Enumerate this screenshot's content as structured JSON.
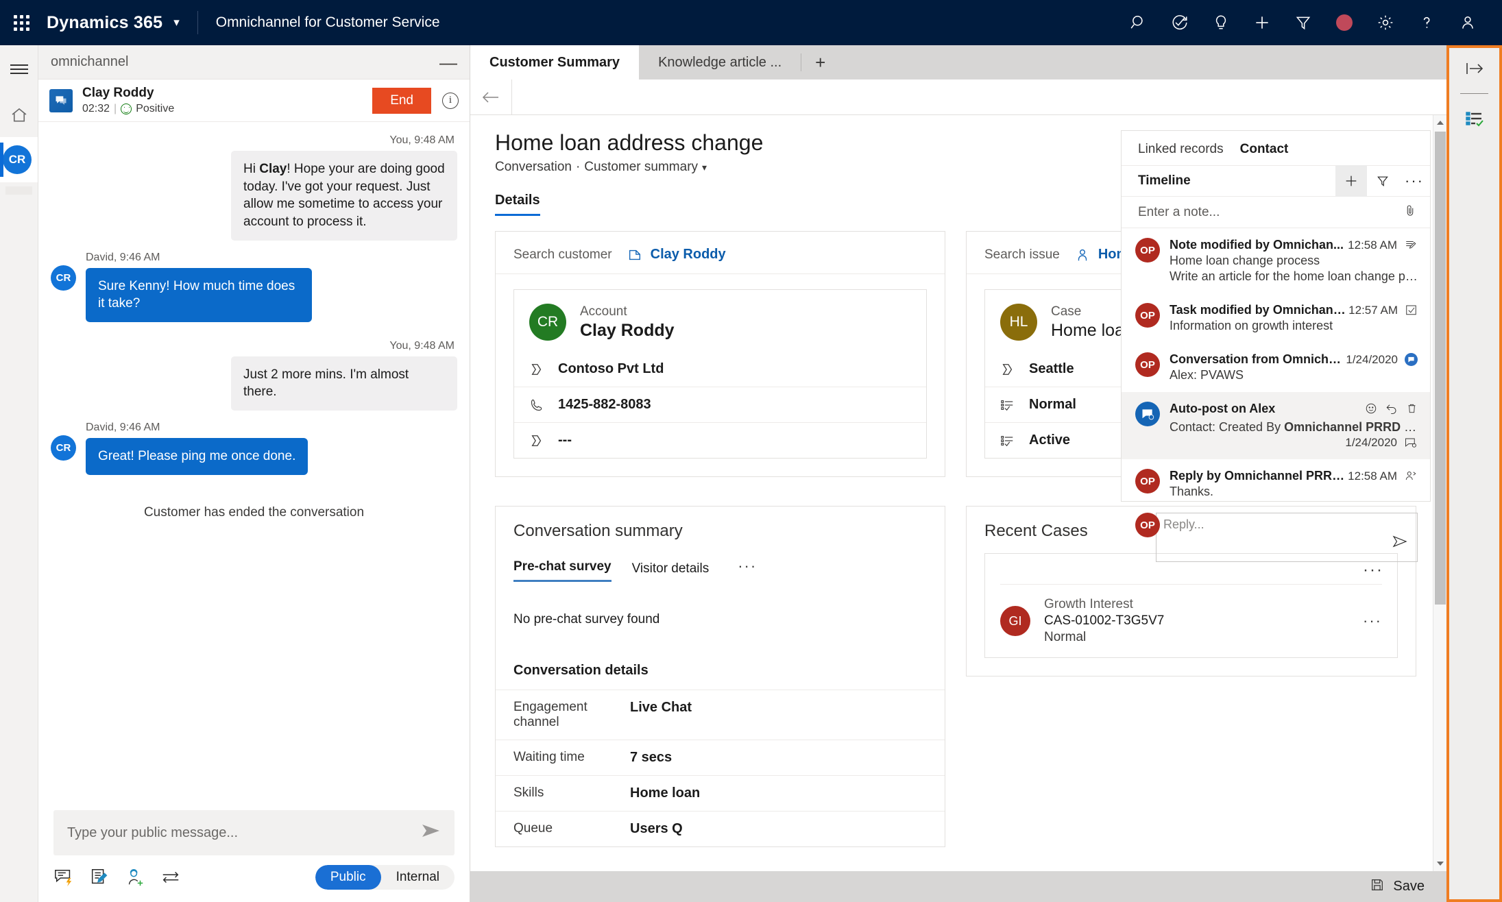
{
  "topnav": {
    "brand": "Dynamics 365",
    "app_name": "Omnichannel for Customer Service",
    "icons": [
      "search-icon",
      "check-circle-arrow-icon",
      "lightbulb-icon",
      "plus-icon",
      "filter-icon",
      "presence-busy-dot",
      "gear-icon",
      "help-question-icon",
      "user-account-icon"
    ]
  },
  "rail": {
    "hamburger": "site-map-menu",
    "home": "home-icon",
    "agent_initials": "CR"
  },
  "chat": {
    "panel_title": "omnichannel",
    "minimize": "—",
    "customer_name": "Clay Roddy",
    "timer": "02:32",
    "separator": "|",
    "sentiment": "Positive",
    "end_button": "End",
    "info_icon": "i",
    "messages": [
      {
        "meta": "You, 9:48 AM",
        "dir": "out",
        "text": "Hi Clay! Hope your are doing good today. I've got your request. Just allow me sometime to access your account to process it.",
        "highlight": "Clay"
      },
      {
        "meta": "David, 9:46 AM",
        "dir": "in",
        "avatar": "CR",
        "text": "Sure Kenny! How much time does it take?"
      },
      {
        "meta": "You, 9:48 AM",
        "dir": "out",
        "text": "Just 2 more mins. I'm almost there."
      },
      {
        "meta": "David, 9:46 AM",
        "dir": "in",
        "avatar": "CR",
        "text": "Great! Please ping me once done."
      }
    ],
    "system_note": "Customer has ended the conversation",
    "composer_placeholder": "Type your public message...",
    "toolbar_icons": [
      "quick-reply-icon",
      "note-edit-icon",
      "add-agent-icon",
      "transfer-icon"
    ],
    "mode_toggle": {
      "public": "Public",
      "internal": "Internal"
    }
  },
  "tabs": {
    "items": [
      {
        "label": "Customer Summary",
        "active": true
      },
      {
        "label": "Knowledge article ...",
        "active": false
      }
    ],
    "add": "+"
  },
  "page": {
    "title": "Home loan address change",
    "breadcrumb_entity": "Conversation",
    "breadcrumb_sep": "·",
    "breadcrumb_form": "Customer summary",
    "section_tab": "Details"
  },
  "customer_card": {
    "search_label": "Search customer",
    "search_value": "Clay Roddy",
    "entity_label": "Account",
    "entity_name": "Clay Roddy",
    "avatar_initials": "CR",
    "avatar_color": "#237b23",
    "rows": [
      {
        "icon": "tag-icon",
        "value": "Contoso Pvt Ltd"
      },
      {
        "icon": "phone-icon",
        "value": "1425-882-8083"
      },
      {
        "icon": "tag-icon",
        "value": "---"
      }
    ]
  },
  "issue_card": {
    "search_label": "Search issue",
    "search_value": "Home loan address change",
    "entity_label": "Case",
    "entity_name": "Home loan address change",
    "avatar_initials": "HL",
    "avatar_color": "#8a6d0b",
    "rows": [
      {
        "icon": "tag-icon",
        "value": "Seattle"
      },
      {
        "icon": "list-check-icon",
        "value": "Normal"
      },
      {
        "icon": "list-check-icon",
        "value": "Active"
      }
    ]
  },
  "conversation_summary": {
    "title": "Conversation summary",
    "tabs": [
      {
        "label": "Pre-chat survey",
        "selected": true
      },
      {
        "label": "Visitor details",
        "selected": false
      }
    ],
    "overflow": "···",
    "empty_text": "No pre-chat survey found",
    "details_heading": "Conversation details",
    "details": [
      {
        "key": "Engagement channel",
        "value": "Live Chat"
      },
      {
        "key": "Waiting time",
        "value": "7 secs"
      },
      {
        "key": "Skills",
        "value": "Home loan"
      },
      {
        "key": "Queue",
        "value": "Users Q"
      }
    ]
  },
  "recent_cases": {
    "title": "Recent Cases",
    "overflow": "···",
    "items": [
      {
        "initials": "GI",
        "name": "Growth Interest",
        "id": "CAS-01002-T3G5V7",
        "priority": "Normal",
        "overflow": "···"
      }
    ]
  },
  "timeline": {
    "tabs": [
      {
        "label": "Linked records",
        "selected": false
      },
      {
        "label": "Contact",
        "selected": true
      }
    ],
    "header": "Timeline",
    "header_icons": [
      "plus-icon",
      "filter-icon",
      "more-ellipsis-icon"
    ],
    "note_placeholder": "Enter a note...",
    "attach_icon": "paperclip-icon",
    "items": [
      {
        "avatar": "OP",
        "title": "Note modified by Omnichan...",
        "line2": "Home loan change process",
        "line3": "Write an article for the home loan change process.",
        "time": "12:58 AM",
        "icon": "note-icon",
        "highlight": false
      },
      {
        "avatar": "OP",
        "title": "Task modified by Omnichann...",
        "line2": "Information on growth interest",
        "time": "12:57 AM",
        "icon": "task-check-icon",
        "highlight": false
      },
      {
        "avatar": "OP",
        "title": "Conversation from Omnichan...",
        "line2": "Alex: PVAWS",
        "time": "1/24/2020",
        "icon": "conversation-badge-icon",
        "highlight": false
      },
      {
        "avatar": "POST",
        "title": "Auto-post on Alex",
        "line2": "Contact: Created By Omnichannel PRRD Pipeline.",
        "time": "1/24/2020",
        "icon": "post-icon",
        "actions": [
          "emoji-icon",
          "reply-arrow-icon",
          "delete-trash-icon"
        ],
        "highlight": true
      },
      {
        "avatar": "OP",
        "title": "Reply by Omnichannel PRRD Pipeline",
        "line2": "Thanks.",
        "time": "12:58 AM",
        "icon": "reply-person-icon",
        "highlight": false
      }
    ],
    "reply_avatar": "OP",
    "reply_placeholder": "Reply...",
    "reply_send": "send-icon"
  },
  "right_pane": {
    "icons": [
      "expand-pane-icon",
      "agent-scripts-icon"
    ],
    "accent": "#ef7d22"
  },
  "savebar": {
    "label": "Save",
    "icon": "save-disk-icon"
  }
}
